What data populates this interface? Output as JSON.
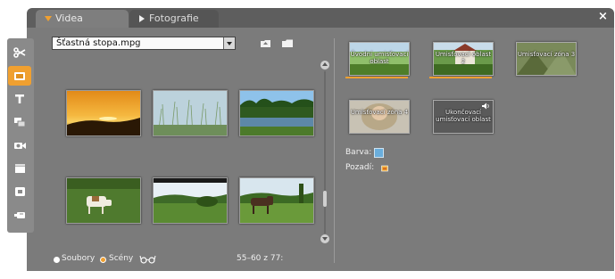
{
  "tabs": {
    "video": "Videa",
    "photos": "Fotografie",
    "close": "×"
  },
  "toolbar": {
    "items": [
      "scissors-icon",
      "menu-icon",
      "title-icon",
      "transition-icon",
      "camera-icon",
      "clapper-icon",
      "disc-icon",
      "plug-icon"
    ],
    "active_index": 1
  },
  "file": {
    "selected": "Šťastná stopa.mpg"
  },
  "thumbnails": [
    {
      "name": "sunset"
    },
    {
      "name": "grass-sky"
    },
    {
      "name": "lake"
    },
    {
      "name": "cow"
    },
    {
      "name": "landscape"
    },
    {
      "name": "horse"
    }
  ],
  "footer": {
    "files_label": "Soubory",
    "scenes_label": "Scény",
    "range": "55–60 z 77:"
  },
  "menu_buttons": [
    {
      "label": "Úvodní umisťovací oblast"
    },
    {
      "label": "Umisťovací oblast 2"
    },
    {
      "label": "Umisťovací zóna 3"
    },
    {
      "label": "Umisťovací zóna 4"
    },
    {
      "label": "Ukončovací umisťovací oblast"
    }
  ],
  "properties": {
    "color_label": "Barva:",
    "background_label": "Pozadí:",
    "color_value": "#6aaedc"
  },
  "colors": {
    "accent": "#f0a030",
    "panel": "#7b7b7b"
  }
}
